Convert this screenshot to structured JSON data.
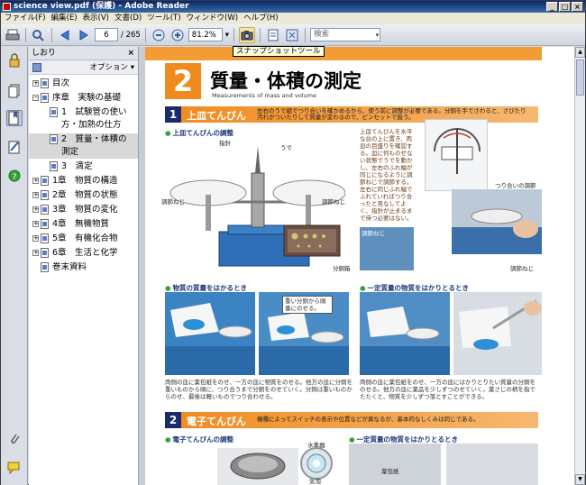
{
  "window": {
    "title": "science view.pdf (保護) - Adobe Reader"
  },
  "menu": [
    "ファイル(F)",
    "編集(E)",
    "表示(V)",
    "文書(D)",
    "ツール(T)",
    "ウィンドウ(W)",
    "ヘルプ(H)"
  ],
  "toolbar": {
    "page_current": "6",
    "page_total": "/ 265",
    "zoom": "81.2%",
    "search_placeholder": "検索",
    "tooltip": "スナップショットツール"
  },
  "bookmarks": {
    "title": "しおり",
    "options_label": "オプション",
    "items": [
      {
        "label": "目次"
      },
      {
        "label": "序章　実験の基礎"
      },
      {
        "label": "1　試験管の使い方・加熱の仕方"
      },
      {
        "label": "2　質量・体積の測定"
      },
      {
        "label": "3　滴定"
      },
      {
        "label": "1章　物質の構造"
      },
      {
        "label": "2章　物質の状態"
      },
      {
        "label": "3章　物質の変化"
      },
      {
        "label": "4章　無機物質"
      },
      {
        "label": "5章　有機化合物"
      },
      {
        "label": "6章　生活と化学"
      },
      {
        "label": "巻末資料"
      }
    ]
  },
  "document": {
    "chapter_number": "2",
    "chapter_title": "質量・体積の測定",
    "chapter_subtitle": "Measurements of mass and volume",
    "section1": {
      "num": "1",
      "title": "上皿てんびん",
      "desc": "左右のうで組でつり合いを確かめるから、使う前に調整が必要である。分銅を手でさわると、さびたり汚れがついたりして質量が変わるので、ピンセットで扱う。"
    },
    "labels": {
      "adjust": "上皿てんびんの調整",
      "pointer": "指針",
      "arm": "うで",
      "adj_screw_l": "調節ねじ",
      "adj_screw_r": "調節ねじ",
      "weights": "分銅箱",
      "balance_adjust": "つり合いの調節",
      "adj_screw2": "調節ねじ",
      "adj_screw3": "調節ねじ",
      "explain": "上皿てんびんを水平な台の上に置き、両皿の目盛りを確認する。皿に何ものせない状態でうでを動かし、左右のふれ幅が同じになるように調節ねじで調節する。左右に同じふれ幅でふれていればつり合ったと見なしてよく、指針が止まるまで待つ必要はない。",
      "measure_mass": "物質の質量をはかるとき",
      "measure_fixed": "一定質量の物質をはかりとるとき",
      "callout": "重い分銅から順番にのせる。",
      "caption_a": "両側の皿に薬包紙をのせ、一方の皿に物質をのせる。他方の皿に分銅を重いものから順に、つり合うまで分銅をのせていく。分銅は重いものからのせ、最後は軽いものでつり合わせる。",
      "caption_b": "両側の皿に薬包紙をのせ、一方の皿にはかりとりたい質量の分銅をのせる。他方の皿に薬品を少しずつのせていく。薬さじの柄を指でたたくと、物質を少しずつ落とすことができる。"
    },
    "section2": {
      "num": "2",
      "title": "電子てんびん",
      "desc": "機種によってスイッチの表示や位置などが異なるが、基本的なしくみは同じである。"
    },
    "labels2": {
      "adjust": "電子てんびんの調整",
      "level": "水準器",
      "bubble": "気泡",
      "fixed": "一定質量の物質をはかりとるとき",
      "paper": "薬包紙"
    }
  }
}
